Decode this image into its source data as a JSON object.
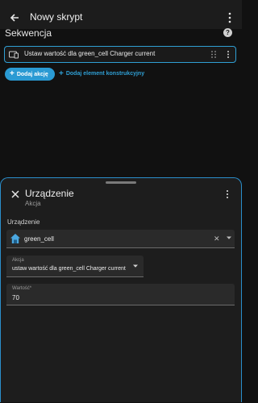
{
  "header": {
    "title": "Nowy skrypt"
  },
  "sequence": {
    "title": "Sekwencja",
    "action_card_label": "Ustaw wartość dla green_cell Charger current",
    "add_action_label": "Dodaj akcję",
    "add_construct_label": "Dodaj element konstrukcyjny"
  },
  "sheet": {
    "title": "Urządzenie",
    "subtitle": "Akcja",
    "device_label": "Urządzenie",
    "device_value": "green_cell",
    "action_label": "Akcja",
    "action_value": "ustaw wartość dla green_cell Charger current",
    "value_label": "Wartość*",
    "value": "70"
  },
  "colors": {
    "accent": "#2a9ad3",
    "background": "#111111",
    "surface": "#1d1d1d"
  },
  "icons": [
    "back-arrow-icon",
    "more-vertical-icon",
    "help-icon",
    "device-icon",
    "drag-handle-icon",
    "plus-icon",
    "close-icon",
    "home-icon",
    "clear-icon",
    "dropdown-arrow-icon"
  ]
}
